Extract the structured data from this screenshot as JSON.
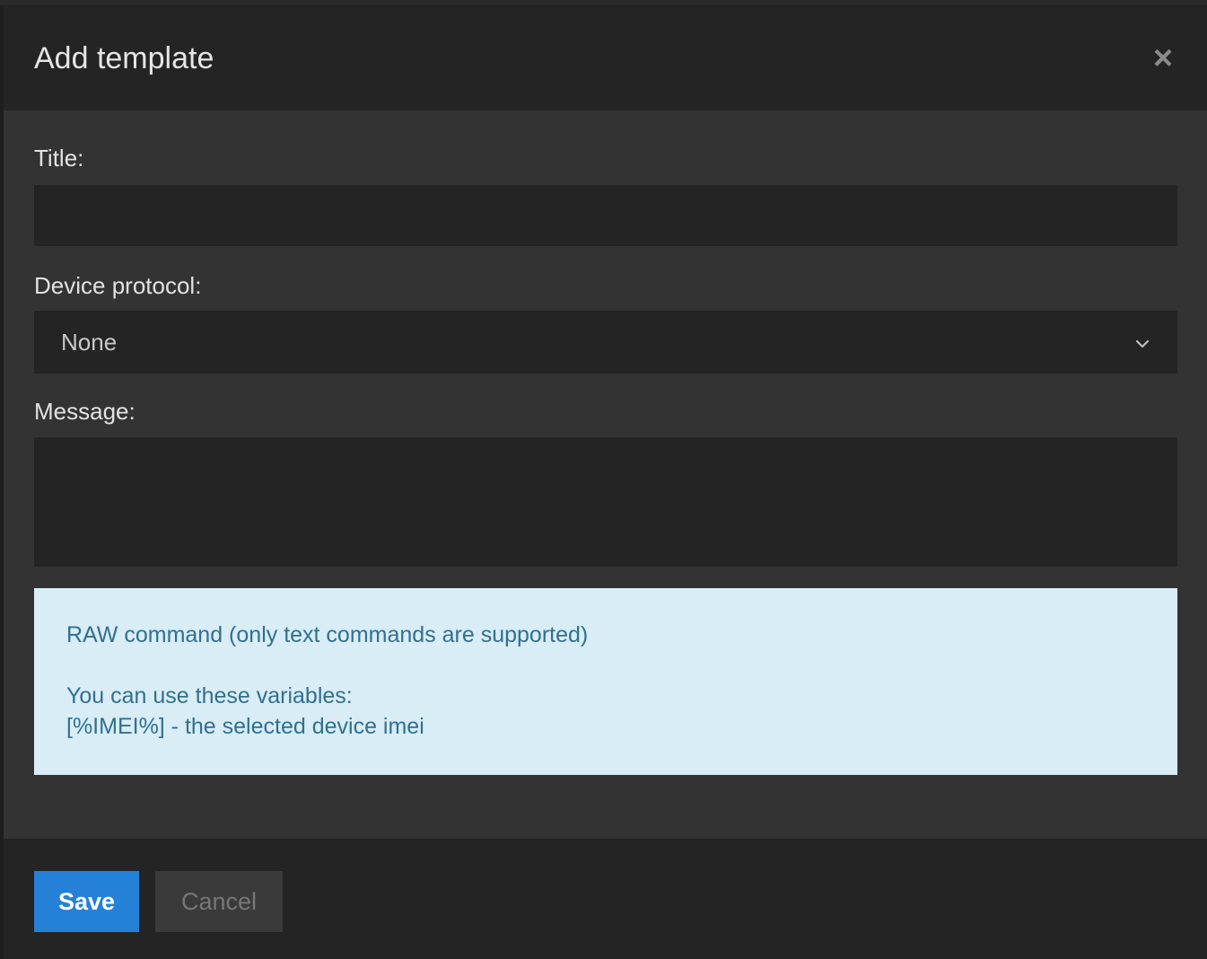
{
  "modal": {
    "title": "Add template",
    "close_symbol": "×"
  },
  "form": {
    "title_label": "Title:",
    "title_value": "",
    "protocol_label": "Device protocol:",
    "protocol_selected": "None",
    "message_label": "Message:",
    "message_value": ""
  },
  "info": {
    "line1": "RAW command (only text commands are supported)",
    "line2": "You can use these variables:",
    "line3": "[%IMEI%] - the selected device imei"
  },
  "footer": {
    "save_label": "Save",
    "cancel_label": "Cancel"
  },
  "icons": {
    "close": "close-icon",
    "dropdown": "chevron-down-icon"
  },
  "colors": {
    "primary_button": "#2580d8",
    "info_background": "#d9edf7",
    "info_text": "#31708f"
  }
}
